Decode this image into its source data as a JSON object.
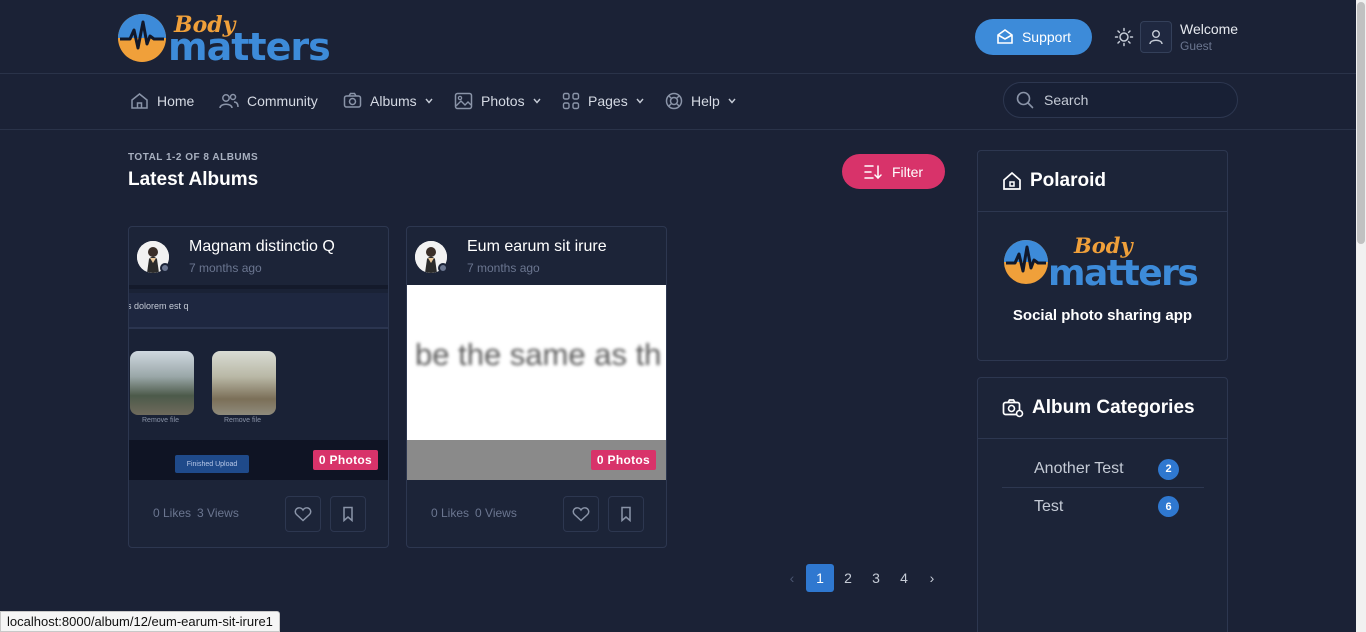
{
  "header": {
    "logo_top": "Body",
    "logo_bottom": "matters",
    "support_label": "Support",
    "welcome": "Welcome",
    "user": "Guest"
  },
  "nav": {
    "items": [
      {
        "label": "Home",
        "icon": "home-icon"
      },
      {
        "label": "Community",
        "icon": "users-icon"
      },
      {
        "label": "Albums",
        "icon": "camera-icon",
        "dropdown": true
      },
      {
        "label": "Photos",
        "icon": "photo-icon",
        "dropdown": true
      },
      {
        "label": "Pages",
        "icon": "grid-icon",
        "dropdown": true
      },
      {
        "label": "Help",
        "icon": "lifebuoy-icon",
        "dropdown": true
      }
    ],
    "search_placeholder": "Search"
  },
  "main": {
    "eyebrow": "TOTAL 1-2 OF 8 ALBUMS",
    "title": "Latest Albums",
    "filter_label": "Filter"
  },
  "albums": [
    {
      "title": "Magnam distinctio Q",
      "time": "7 months ago",
      "photos_badge": "0 Photos",
      "likes": "0 Likes",
      "views": "3 Views",
      "thumb_text": "s dolorem est q",
      "thumb_remove_1": "Remove file",
      "thumb_remove_2": "Remove file",
      "thumb_button": "Finished Upload"
    },
    {
      "title": "Eum earum sit irure",
      "time": "7 months ago",
      "photos_badge": "0 Photos",
      "likes": "0 Likes",
      "views": "0 Views",
      "thumb_text": "be the same as th"
    }
  ],
  "pagination": {
    "prev": "‹",
    "pages": [
      "1",
      "2",
      "3",
      "4"
    ],
    "active": "1",
    "next": "›"
  },
  "sidebar": {
    "polaroid_title": "Polaroid",
    "tagline": "Social photo sharing app",
    "categories_title": "Album Categories",
    "categories": [
      {
        "label": "Another Test",
        "count": "2"
      },
      {
        "label": "Test",
        "count": "6"
      }
    ]
  },
  "statusbar": {
    "url": "localhost:8000/album/12/eum-earum-sit-irure1"
  },
  "colors": {
    "background": "#1b2236",
    "accent_blue": "#3d8bd9",
    "accent_pink": "#d8336a",
    "badge_blue": "#2f78d0"
  }
}
